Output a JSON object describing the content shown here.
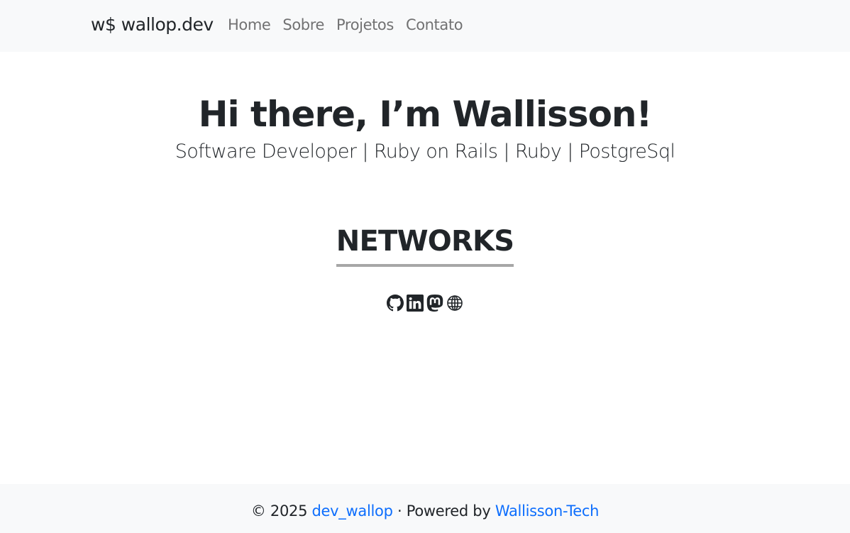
{
  "navbar": {
    "brand": "w$ wallop.dev",
    "links": [
      "Home",
      "Sobre",
      "Projetos",
      "Contato"
    ]
  },
  "hero": {
    "title": "Hi there, I’m Wallisson!",
    "subtitle": "Software Developer | Ruby on Rails | Ruby | PostgreSql"
  },
  "networks": {
    "heading": "NETWORKS",
    "icons": [
      "github-icon",
      "linkedin-icon",
      "mastodon-icon",
      "globe-icon"
    ]
  },
  "footer": {
    "copyright": "© 2025",
    "author_link": "dev_wallop",
    "powered_text": "· Powered by",
    "powered_link": "Wallisson-Tech"
  },
  "colors": {
    "navbar_bg": "#f8f9fa",
    "text": "#212529",
    "link": "#0d6efd",
    "underline": "#a7a7a7"
  }
}
